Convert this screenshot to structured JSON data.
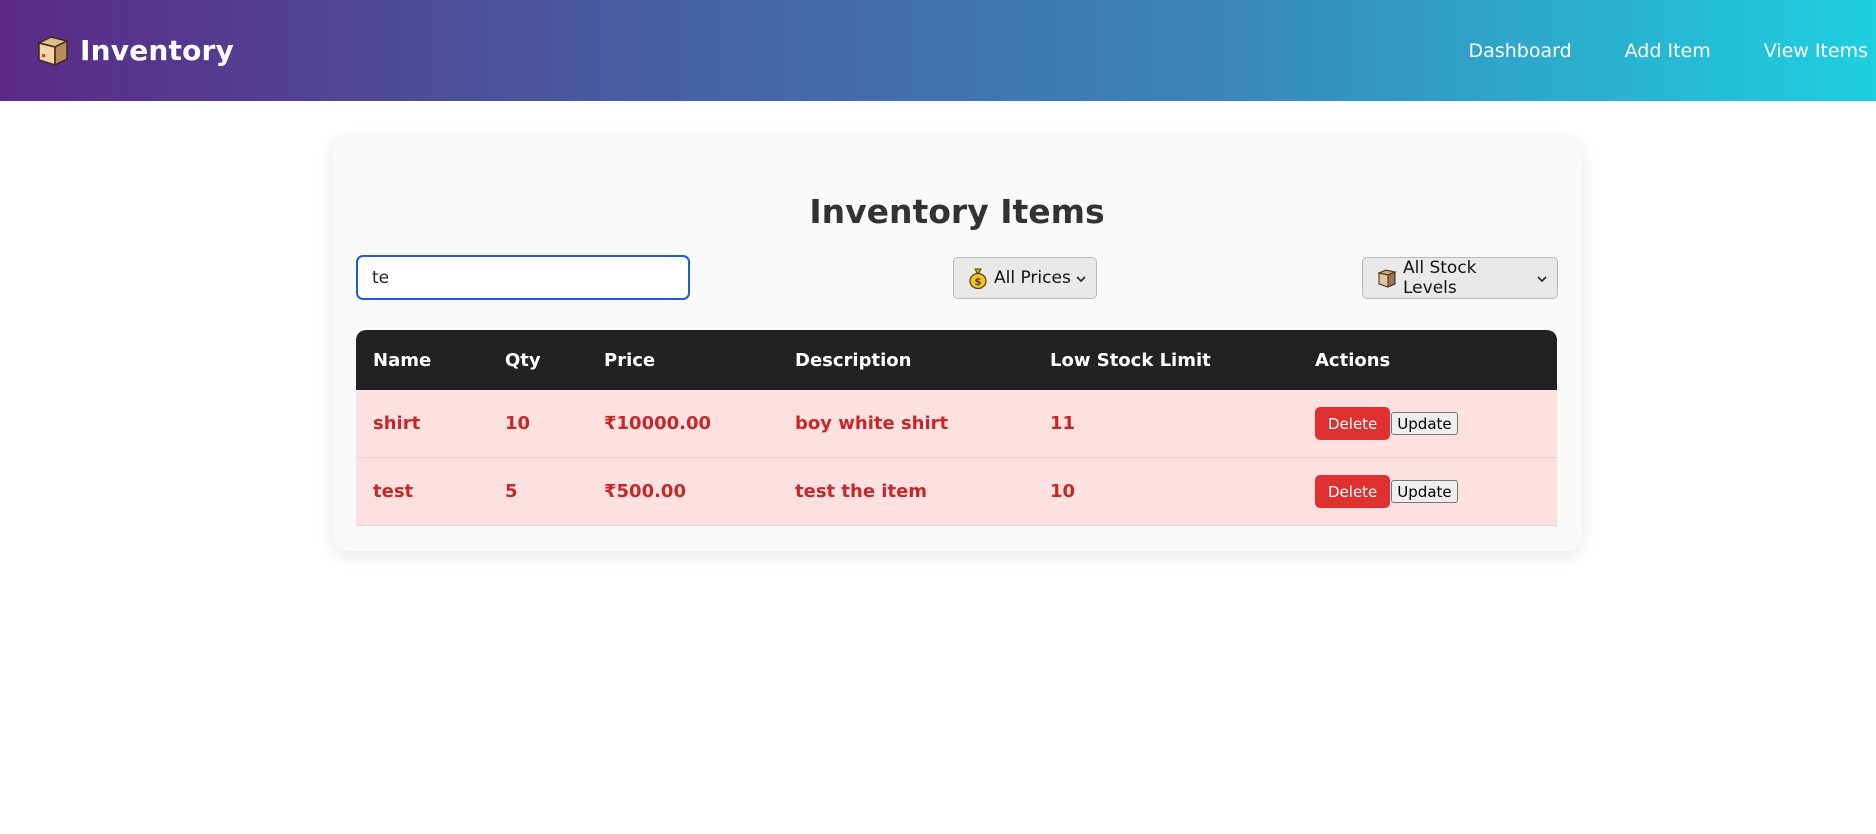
{
  "header": {
    "brand": "Inventory",
    "brand_icon": "package-box-icon",
    "nav": [
      {
        "label": "Dashboard"
      },
      {
        "label": "Add Item"
      },
      {
        "label": "View Items"
      }
    ],
    "gradient_start": "#5b2a86",
    "gradient_end": "#1ecfe0"
  },
  "main": {
    "title": "Inventory Items",
    "search": {
      "value": "te",
      "placeholder": ""
    },
    "price_filter": {
      "icon": "money-bag-icon",
      "selected": "All Prices"
    },
    "stock_filter": {
      "icon": "package-box-icon",
      "selected": "All Stock Levels"
    }
  },
  "table": {
    "columns": [
      "Name",
      "Qty",
      "Price",
      "Description",
      "Low Stock Limit",
      "Actions"
    ],
    "rows": [
      {
        "name": "shirt",
        "qty": "10",
        "price": "₹10000.00",
        "description": "boy white shirt",
        "low_stock_limit": "11",
        "delete_label": "Delete",
        "update_label": "Update"
      },
      {
        "name": "test",
        "qty": "5",
        "price": "₹500.00",
        "description": "test the item",
        "low_stock_limit": "10",
        "delete_label": "Delete",
        "update_label": "Update"
      }
    ],
    "low_stock_row_bg": "#fde1e1",
    "low_stock_text_color": "#c62828",
    "delete_button_color": "#e03131"
  }
}
